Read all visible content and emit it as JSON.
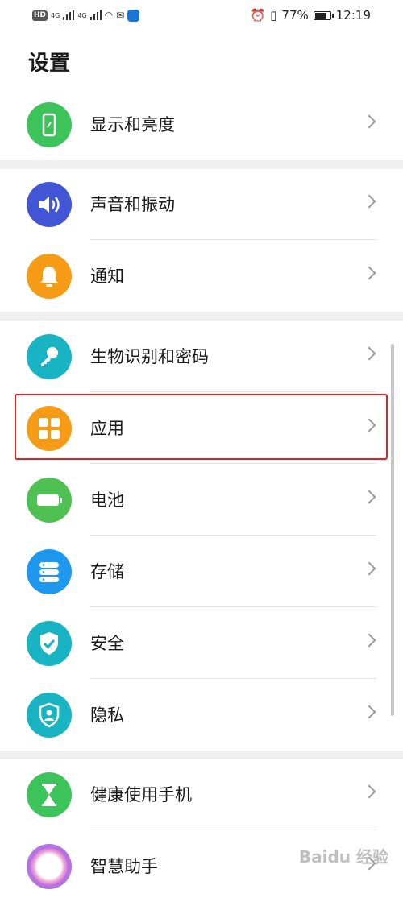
{
  "status_bar": {
    "left_badge": "HD",
    "network_1": "4G",
    "network_2": "4G",
    "battery_percent": "77%",
    "battery_level": 0.77,
    "time": "12:19"
  },
  "page_title": "设置",
  "items": [
    {
      "label": "显示和亮度",
      "icon": "phone-display-icon",
      "color": "#3cc35a"
    },
    {
      "label": "声音和振动",
      "icon": "speaker-icon",
      "color": "#4255d4"
    },
    {
      "label": "通知",
      "icon": "bell-icon",
      "color": "#f59b15"
    },
    {
      "label": "生物识别和密码",
      "icon": "key-icon",
      "color": "#19b4c4"
    },
    {
      "label": "应用",
      "icon": "apps-grid-icon",
      "color": "#f59b15"
    },
    {
      "label": "电池",
      "icon": "battery-icon",
      "color": "#4fc152"
    },
    {
      "label": "存储",
      "icon": "storage-icon",
      "color": "#1e98ee"
    },
    {
      "label": "安全",
      "icon": "shield-check-icon",
      "color": "#19b4c4"
    },
    {
      "label": "隐私",
      "icon": "privacy-shield-icon",
      "color": "#19b4c4"
    },
    {
      "label": "健康使用手机",
      "icon": "hourglass-icon",
      "color": "#3cc35a"
    },
    {
      "label": "智慧助手",
      "icon": "assistant-icon",
      "color": "#c36bdc"
    }
  ],
  "watermark": "Baidu 经验"
}
